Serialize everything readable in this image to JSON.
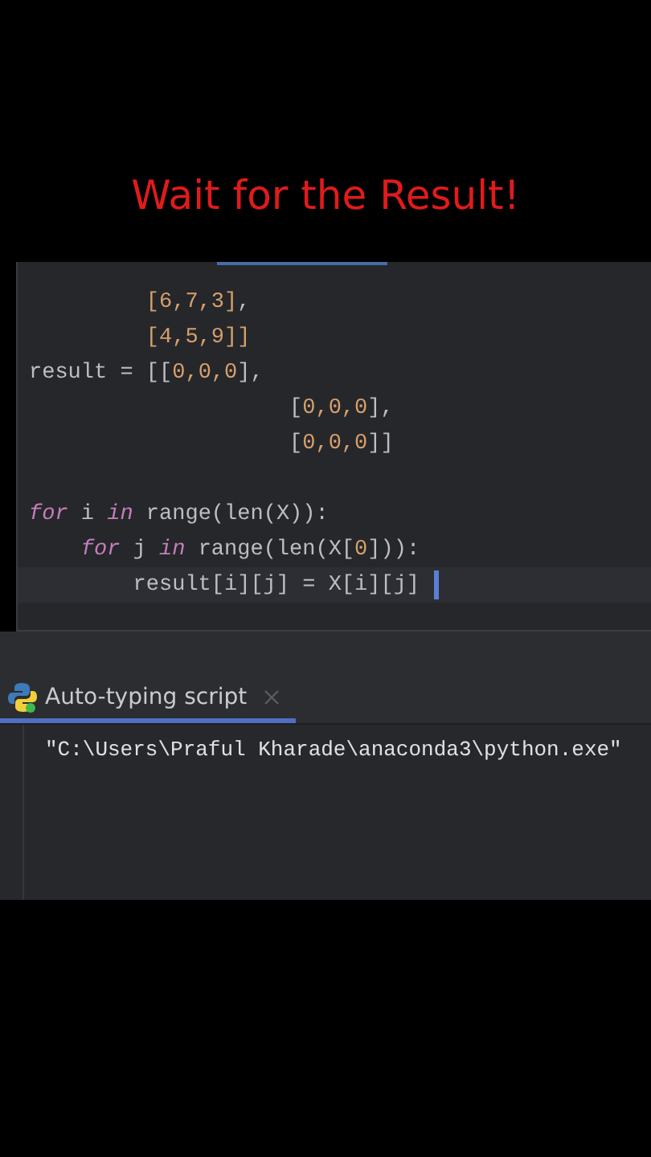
{
  "caption": "Wait for the Result!",
  "editor": {
    "lines": [
      {
        "kind": "list_item",
        "current": false,
        "tokens": [
          {
            "kind": "number",
            "text": "[6,7,3]"
          },
          {
            "kind": "plain",
            "text": ","
          }
        ]
      },
      {
        "kind": "list_item",
        "current": false,
        "tokens": [
          {
            "kind": "number",
            "text": "[4,5,9]]"
          }
        ]
      },
      {
        "kind": "top",
        "current": false,
        "tokens": [
          {
            "kind": "plain",
            "text": "result = [["
          },
          {
            "kind": "number",
            "text": "0,0,0"
          },
          {
            "kind": "plain",
            "text": "],"
          }
        ]
      },
      {
        "kind": "nested_list_item",
        "current": false,
        "tokens": [
          {
            "kind": "plain",
            "text": "["
          },
          {
            "kind": "number",
            "text": "0,0,0"
          },
          {
            "kind": "plain",
            "text": "],"
          }
        ]
      },
      {
        "kind": "nested_list_item",
        "current": false,
        "tokens": [
          {
            "kind": "plain",
            "text": "["
          },
          {
            "kind": "number",
            "text": "0,0,0"
          },
          {
            "kind": "plain",
            "text": "]]"
          }
        ]
      },
      {
        "kind": "blank",
        "current": false
      },
      {
        "kind": "top",
        "current": false,
        "tokens": [
          {
            "kind": "keyword",
            "text": "for"
          },
          {
            "kind": "plain",
            "text": " i "
          },
          {
            "kind": "keyword",
            "text": "in"
          },
          {
            "kind": "plain",
            "text": " range(len(X)):"
          }
        ]
      },
      {
        "kind": "block",
        "current": false,
        "tokens": [
          {
            "kind": "keyword",
            "text": "for"
          },
          {
            "kind": "plain",
            "text": " j "
          },
          {
            "kind": "keyword",
            "text": "in"
          },
          {
            "kind": "plain",
            "text": " range(len(X["
          },
          {
            "kind": "number",
            "text": "0"
          },
          {
            "kind": "plain",
            "text": "])):"
          }
        ]
      },
      {
        "kind": "inner_block",
        "current": true,
        "tokens": [
          {
            "kind": "plain",
            "text": "result[i][j] = X[i][j]"
          }
        ]
      }
    ]
  },
  "run_panel": {
    "tab": {
      "label": "Auto-typing script",
      "selected": true
    },
    "console_lines": [
      "\"C:\\Users\\Praful Kharade\\anaconda3\\python.exe\""
    ]
  }
}
